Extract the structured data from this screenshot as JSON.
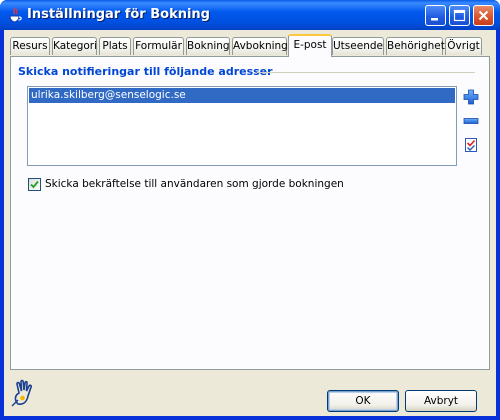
{
  "window": {
    "title": "Inställningar för Bokning"
  },
  "tabs": [
    {
      "label": "Resurs"
    },
    {
      "label": "Kategori"
    },
    {
      "label": "Plats"
    },
    {
      "label": "Formulär"
    },
    {
      "label": "Bokning"
    },
    {
      "label": "Avbokning"
    },
    {
      "label": "E-post",
      "active": true
    },
    {
      "label": "Utseende"
    },
    {
      "label": "Behörighet"
    },
    {
      "label": "Övrigt"
    }
  ],
  "email_panel": {
    "group_title": "Skicka notifieringar till följande adresser",
    "addresses": [
      "ulrika.skilberg@senselogic.se"
    ],
    "selected_index": 0,
    "side_buttons": [
      {
        "name": "add",
        "icon": "plus-icon"
      },
      {
        "name": "remove",
        "icon": "minus-icon"
      },
      {
        "name": "edit",
        "icon": "edit-list-icon"
      }
    ],
    "confirmation_checkbox": {
      "label": "Skicka bekräftelse till användaren som gjorde bokningen",
      "checked": true
    }
  },
  "footer": {
    "ok_label": "OK",
    "cancel_label": "Avbryt",
    "logo_icon": "hand-logo-icon"
  },
  "colors": {
    "accent": "#0046d5",
    "selection": "#316ac5",
    "titlebar": "#0058ee"
  }
}
